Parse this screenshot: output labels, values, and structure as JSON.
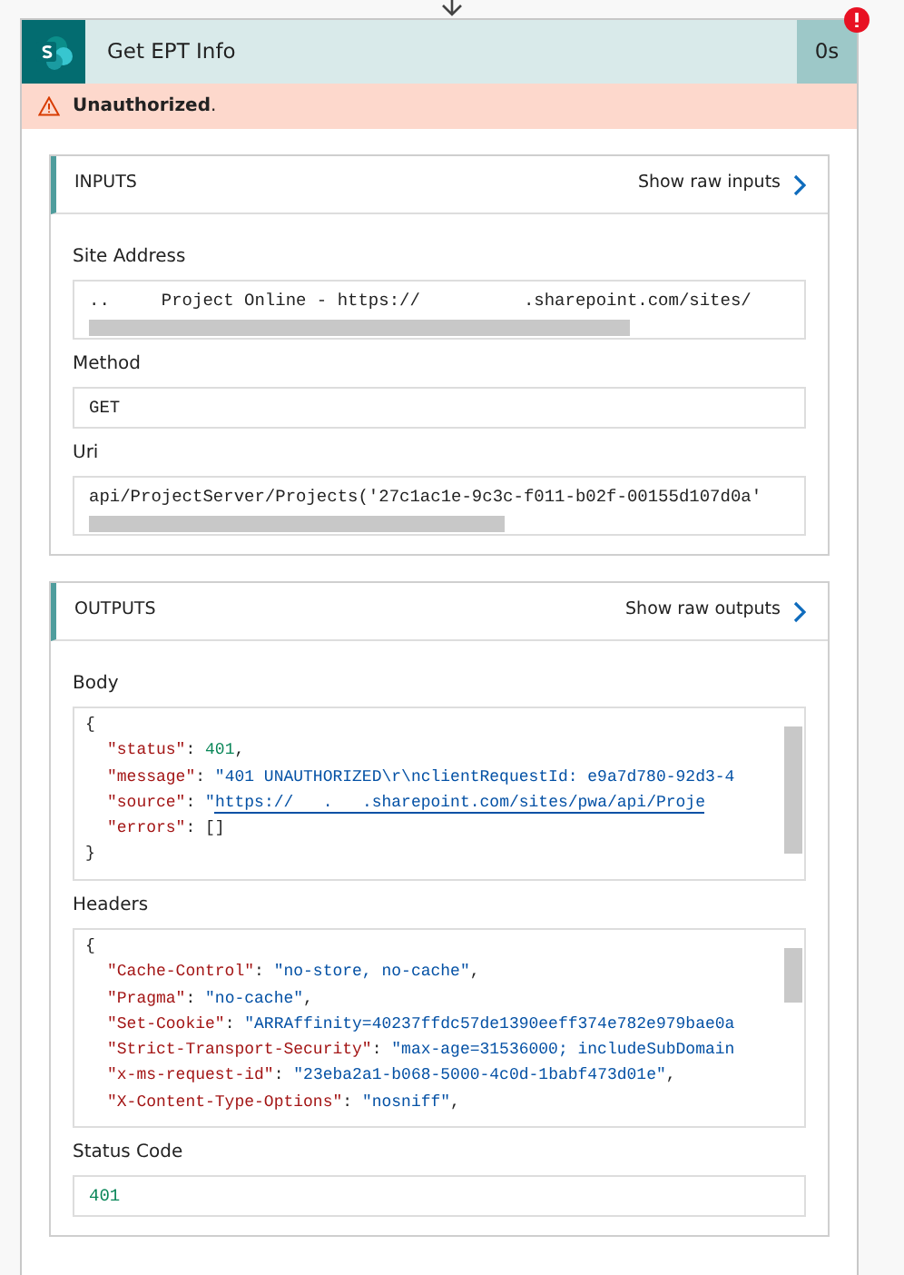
{
  "step": {
    "title": "Get EPT Info",
    "duration": "0s",
    "failed": true,
    "error": "**Unauthorized**."
  },
  "inputs": {
    "heading": "INPUTS",
    "raw_link": "Show raw inputs",
    "fields": [
      {
        "label": "Site Address",
        "kind": "scroll-text",
        "value": "..     Project Online - https://          .sharepoint.com/sites/"
      },
      {
        "label": "Method",
        "kind": "text",
        "value": "GET"
      },
      {
        "label": "Uri",
        "kind": "scroll-text",
        "value": "api/ProjectServer/Projects('27c1ac1e-9c3c-f011-b02f-00155d107d0a'"
      }
    ]
  },
  "outputs": {
    "heading": "OUTPUTS",
    "raw_link": "Show raw outputs",
    "fields": [
      {
        "label": "Body",
        "kind": "code",
        "lines": [
          {
            "kind": "brace",
            "tokens": [
              {
                "text": "{",
                "kind": "punct"
              }
            ]
          },
          {
            "kind": "entry",
            "tokens": [
              {
                "text": "\"status\"",
                "kind": "key"
              },
              {
                "text": ": ",
                "kind": "punct"
              },
              {
                "text": "401",
                "kind": "number"
              },
              {
                "text": ",",
                "kind": "punct"
              }
            ]
          },
          {
            "kind": "entry",
            "tokens": [
              {
                "text": "\"message\"",
                "kind": "key"
              },
              {
                "text": ": ",
                "kind": "punct"
              },
              {
                "text": "\"401 UNAUTHORIZED\\r\\nclientRequestId: e9a7d780-92d3-4",
                "kind": "string"
              }
            ]
          },
          {
            "kind": "entry",
            "tokens": [
              {
                "text": "\"source\"",
                "kind": "key"
              },
              {
                "text": ": ",
                "kind": "punct"
              },
              {
                "text": "\"",
                "kind": "string"
              },
              {
                "text": "https://   .   .sharepoint.com/sites/pwa/api/Proje",
                "kind": "link"
              }
            ]
          },
          {
            "kind": "entry",
            "tokens": [
              {
                "text": "\"errors\"",
                "kind": "key"
              },
              {
                "text": ": []",
                "kind": "punct"
              }
            ]
          },
          {
            "kind": "brace",
            "tokens": [
              {
                "text": "}",
                "kind": "punct"
              }
            ]
          }
        ]
      },
      {
        "label": "Headers",
        "kind": "code",
        "lines": [
          {
            "kind": "brace",
            "tokens": [
              {
                "text": "{",
                "kind": "punct"
              }
            ]
          },
          {
            "kind": "entry",
            "tokens": [
              {
                "text": "\"Cache-Control\"",
                "kind": "key"
              },
              {
                "text": ": ",
                "kind": "punct"
              },
              {
                "text": "\"no-store, no-cache\"",
                "kind": "string"
              },
              {
                "text": ",",
                "kind": "punct"
              }
            ]
          },
          {
            "kind": "entry",
            "tokens": [
              {
                "text": "\"Pragma\"",
                "kind": "key"
              },
              {
                "text": ": ",
                "kind": "punct"
              },
              {
                "text": "\"no-cache\"",
                "kind": "string"
              },
              {
                "text": ",",
                "kind": "punct"
              }
            ]
          },
          {
            "kind": "entry",
            "tokens": [
              {
                "text": "\"Set-Cookie\"",
                "kind": "key"
              },
              {
                "text": ": ",
                "kind": "punct"
              },
              {
                "text": "\"ARRAffinity=40237ffdc57de1390eeff374e782e979bae0a",
                "kind": "string"
              }
            ]
          },
          {
            "kind": "entry",
            "tokens": [
              {
                "text": "\"Strict-Transport-Security\"",
                "kind": "key"
              },
              {
                "text": ": ",
                "kind": "punct"
              },
              {
                "text": "\"max-age=31536000; includeSubDomain",
                "kind": "string"
              }
            ]
          },
          {
            "kind": "entry",
            "tokens": [
              {
                "text": "\"x-ms-request-id\"",
                "kind": "key"
              },
              {
                "text": ": ",
                "kind": "punct"
              },
              {
                "text": "\"23eba2a1-b068-5000-4c0d-1babf473d01e\"",
                "kind": "string"
              },
              {
                "text": ",",
                "kind": "punct"
              }
            ]
          },
          {
            "kind": "entry",
            "tokens": [
              {
                "text": "\"X-Content-Type-Options\"",
                "kind": "key"
              },
              {
                "text": ": ",
                "kind": "punct"
              },
              {
                "text": "\"nosniff\"",
                "kind": "string"
              },
              {
                "text": ",",
                "kind": "punct"
              }
            ]
          }
        ]
      },
      {
        "label": "Status Code",
        "kind": "number",
        "value": "401"
      }
    ]
  }
}
